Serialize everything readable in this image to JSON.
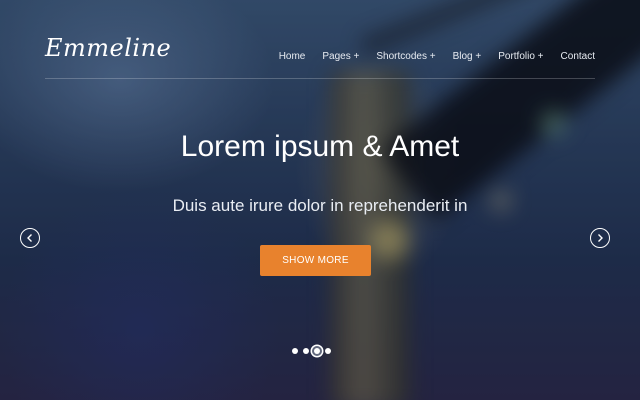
{
  "brand": {
    "logo_text": "Emmeline"
  },
  "nav": {
    "items": [
      {
        "label": "Home"
      },
      {
        "label": "Pages +"
      },
      {
        "label": "Shortcodes +"
      },
      {
        "label": "Blog +"
      },
      {
        "label": "Portfolio +"
      },
      {
        "label": "Contact"
      }
    ]
  },
  "hero": {
    "title": "Lorem ipsum & Amet",
    "subtitle": "Duis aute irure dolor in reprehenderit in",
    "cta_label": "SHOW MORE",
    "slides_total": 4,
    "active_slide": 3
  },
  "colors": {
    "accent": "#e8822d",
    "text": "#ffffff"
  },
  "icons": {
    "prev": "chevron-left-icon",
    "next": "chevron-right-icon"
  }
}
